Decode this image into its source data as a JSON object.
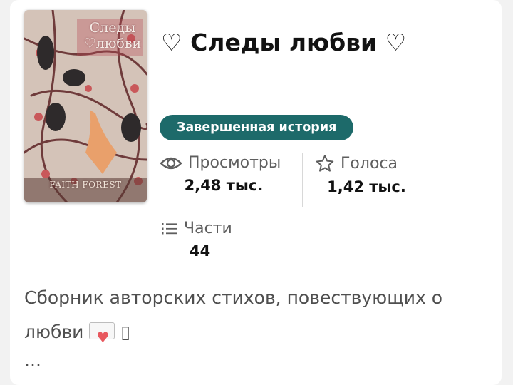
{
  "cover": {
    "title_line1": "Следы",
    "title_line2": "♡любви",
    "author": "FAITH FOREST"
  },
  "story": {
    "title": "♡ Следы любви ♡",
    "status_badge": "Завершенная история"
  },
  "stats": {
    "views": {
      "label": "Просмотры",
      "value": "2,48 тыс.",
      "icon": "eye-icon"
    },
    "votes": {
      "label": "Голоса",
      "value": "1,42 тыс.",
      "icon": "star-icon"
    },
    "parts": {
      "label": "Части",
      "value": "44",
      "icon": "list-icon"
    }
  },
  "description": {
    "text": "Сборник авторских стихов, повествующих о любви",
    "emoji": "love-letter",
    "missing_glyph": "▯",
    "more": "…"
  },
  "colors": {
    "badge": "#1d6a6a",
    "text": "#121212",
    "muted": "#5e5e5e"
  }
}
